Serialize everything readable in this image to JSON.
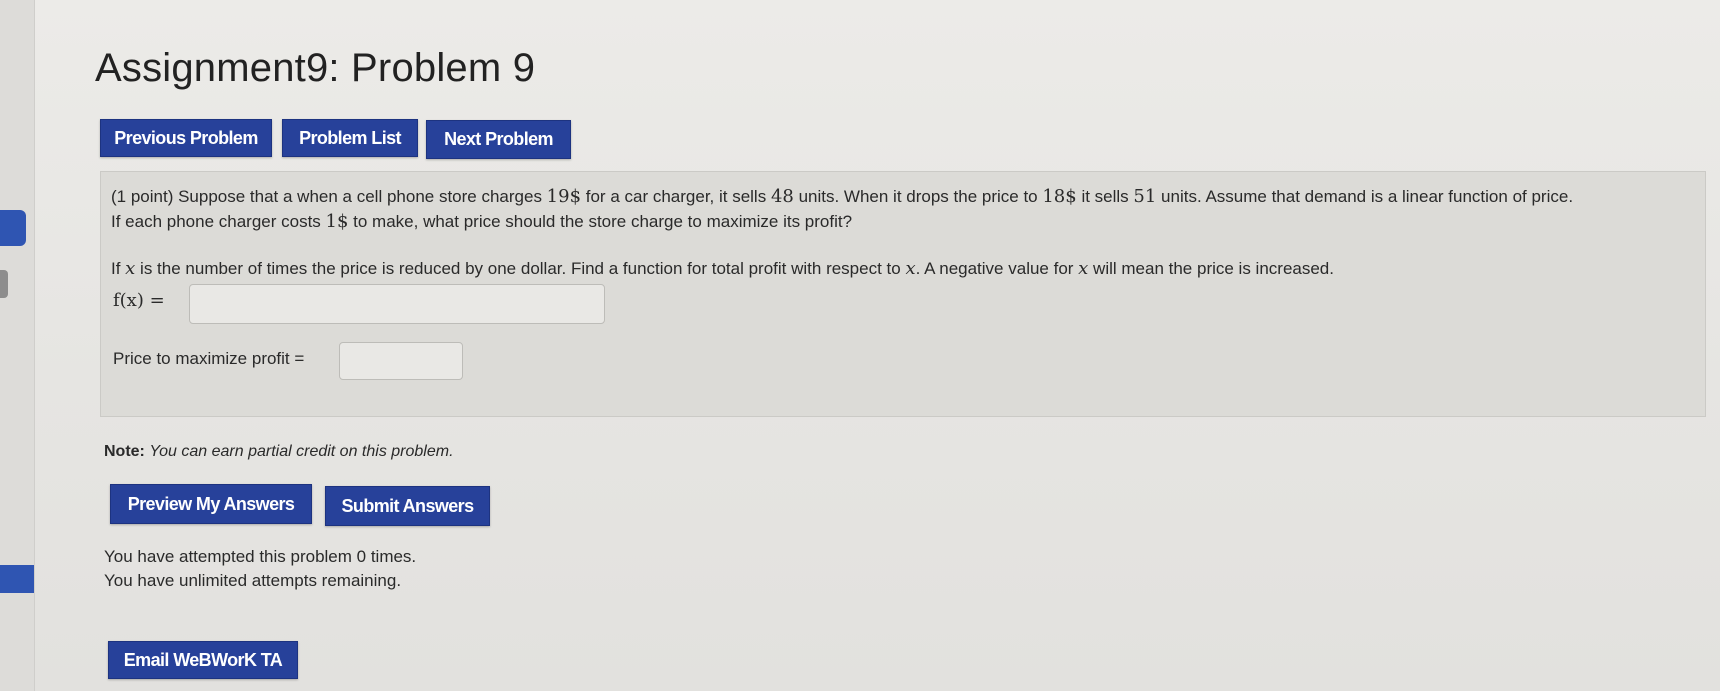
{
  "page": {
    "title": "Assignment9: Problem 9"
  },
  "nav": {
    "previous_label": "Previous Problem",
    "list_label": "Problem List",
    "next_label": "Next Problem"
  },
  "problem": {
    "statement_1": "(1 point) Suppose that a when a cell phone store charges ",
    "price_high": "19$",
    "statement_2": " for a car charger, it sells ",
    "units_high": "48",
    "statement_3": " units. When it drops the price to ",
    "price_low": "18$",
    "statement_4": " it sells ",
    "units_low": "51",
    "statement_5": " units. Assume that demand is a linear function of price.",
    "statement_6": "If each phone charger costs ",
    "cost": "1$",
    "statement_7": " to make, what price should the store charge to maximize its profit?",
    "q_part1": "If ",
    "q_var1": "x",
    "q_part2": " is the number of times the price is reduced by one dollar. Find a function for total profit with respect to ",
    "q_var2": "x",
    "q_part3": ". A negative value for ",
    "q_var3": "x",
    "q_part4": " will mean the price is increased.",
    "fx_label": "f(x) =",
    "fx_value": "",
    "price_label": "Price to maximize profit =",
    "price_value": ""
  },
  "note": {
    "label": "Note:",
    "text": "You can earn partial credit on this problem."
  },
  "actions": {
    "preview_label": "Preview My Answers",
    "submit_label": "Submit Answers"
  },
  "attempts": {
    "line1": "You have attempted this problem 0 times.",
    "line2": "You have unlimited attempts remaining."
  },
  "email": {
    "label": "Email WeBWorK TA"
  },
  "colors": {
    "button_bg": "#27419a",
    "problem_bg": "#dcdbd7",
    "page_bg": "#e8e7e4"
  }
}
